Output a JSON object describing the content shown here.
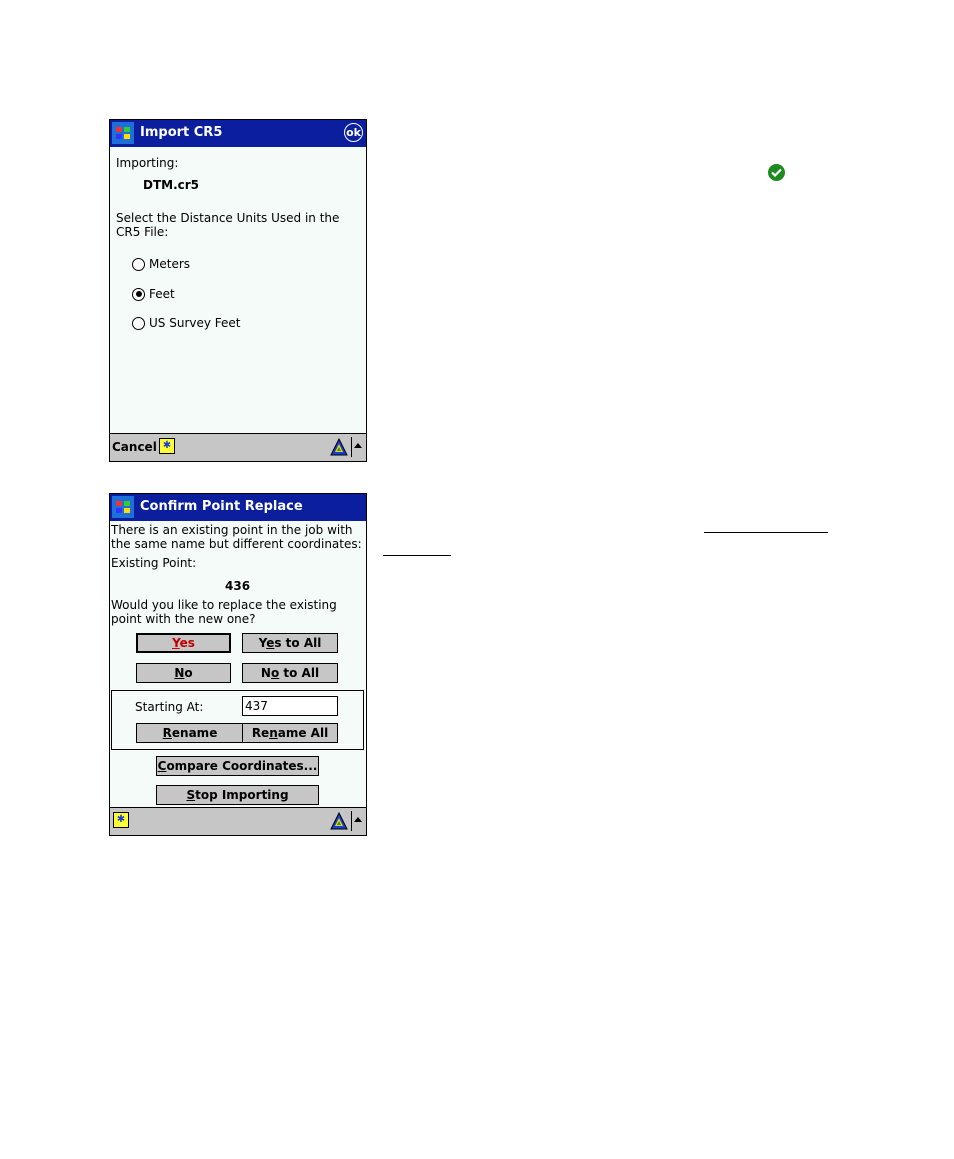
{
  "import_dialog": {
    "title": "Import CR5",
    "ok_label": "ok",
    "importing_label": "Importing:",
    "filename": "DTM.cr5",
    "prompt": [
      "Select the Distance Units Used in the",
      "CR5 File:"
    ],
    "options": [
      {
        "label": "Meters",
        "selected": false
      },
      {
        "label": "Feet",
        "selected": true
      },
      {
        "label": "US Survey Feet",
        "selected": false
      }
    ],
    "taskbar": {
      "cancel_label": "Cancel"
    }
  },
  "confirm_dialog": {
    "title": "Confirm Point Replace",
    "message": [
      "There is an existing point in the job with",
      "the same name but different coordinates:"
    ],
    "existing_label": "Existing Point:",
    "existing_point": "436",
    "question": [
      "Would you like to replace the existing",
      "point with the new one?"
    ],
    "buttons": {
      "yes": {
        "pre": "",
        "u": "Y",
        "post": "es"
      },
      "yes_all": {
        "pre": "Y",
        "u": "e",
        "post": "s to All"
      },
      "no": {
        "pre": "",
        "u": "N",
        "post": "o"
      },
      "no_all": {
        "pre": "N",
        "u": "o",
        "post": " to All"
      },
      "rename": {
        "pre": "",
        "u": "R",
        "post": "ename"
      },
      "rename_all": {
        "pre": "Re",
        "u": "n",
        "post": "ame All"
      },
      "compare": {
        "pre": "",
        "u": "C",
        "post": "ompare Coordinates..."
      },
      "stop": {
        "pre": "",
        "u": "S",
        "post": "top Importing"
      }
    },
    "starting_at_label": "Starting At:",
    "starting_at_value": "437"
  },
  "colors": {
    "titlebar": "#0b1f9e",
    "check": "#1f8a1f",
    "default_button_text": "#c00000"
  }
}
